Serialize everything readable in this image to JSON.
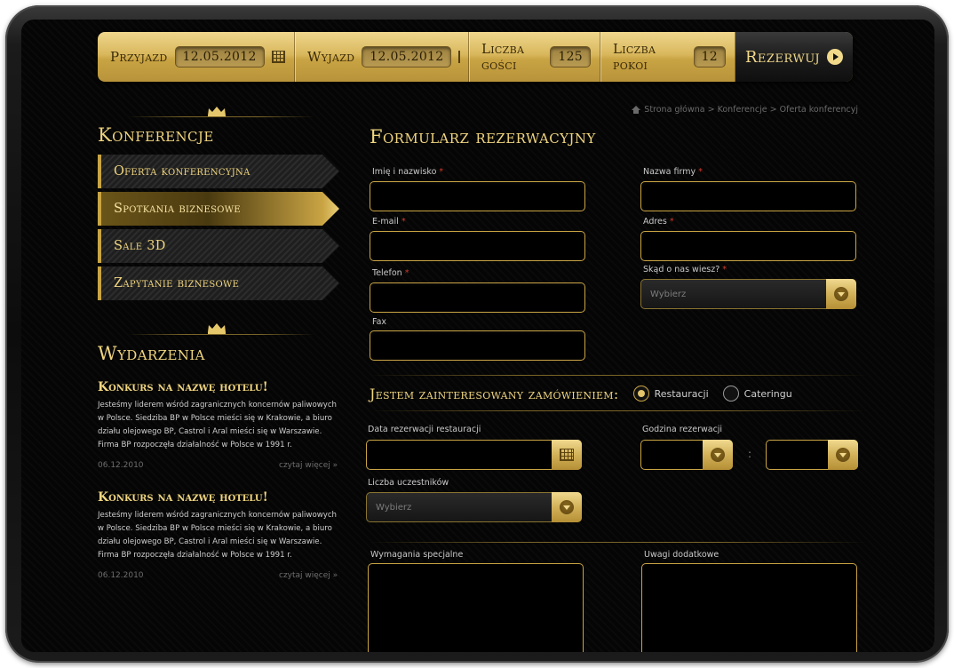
{
  "booking_bar": {
    "arrival_label": "Przyjazd",
    "arrival_value": "12.05.2012",
    "departure_label": "Wyjazd",
    "departure_value": "12.05.2012",
    "guests_label": "Liczba gości",
    "guests_value": "125",
    "rooms_label": "Liczba pokoi",
    "rooms_value": "12",
    "reserve_label": "Rezerwuj"
  },
  "breadcrumb": {
    "text": "Strona główna > Konferencje > Oferta konferencyj"
  },
  "sidebar": {
    "title": "Konferencje",
    "items": [
      {
        "label": "Oferta konferencyjna"
      },
      {
        "label": "Spotkania biznesowe"
      },
      {
        "label": "Sale 3D"
      },
      {
        "label": "Zapytanie biznesowe"
      }
    ]
  },
  "events": {
    "title": "Wydarzenia",
    "items": [
      {
        "title": "Konkurs na nazwę hotelu!",
        "body": "Jesteśmy liderem wśród zagranicznych koncernów paliwowych w Polsce. Siedziba BP w Polsce mieści się w Krakowie, a biuro działu olejowego BP, Castrol i Aral mieści się w Warszawie. Firma BP rozpoczęła działalność w Polsce w 1991 r.",
        "date": "06.12.2010",
        "more": "czytaj więcej »"
      },
      {
        "title": "Konkurs na nazwę hotelu!",
        "body": "Jesteśmy liderem wśród zagranicznych koncernów paliwowych w Polsce. Siedziba BP w Polsce mieści się w Krakowie, a biuro działu olejowego BP, Castrol i Aral mieści się w Warszawie. Firma BP rozpoczęła działalność w Polsce w 1991 r.",
        "date": "06.12.2010",
        "more": "czytaj więcej »"
      }
    ]
  },
  "form": {
    "title": "Formularz rezerwacyjny",
    "name_label": "Imię i nazwisko",
    "company_label": "Nazwa firmy",
    "email_label": "E-mail",
    "address_label": "Adres",
    "phone_label": "Telefon",
    "source_label": "Skąd o nas wiesz?",
    "source_placeholder": "Wybierz",
    "fax_label": "Fax",
    "required_mark": "*",
    "interest_label": "Jestem zainteresowany zamówieniem:",
    "option_restaurant": "Restauracji",
    "option_catering": "Cateringu",
    "res_date_label": "Data rezerwacji restauracji",
    "res_time_label": "Godzina rezerwacji",
    "time_separator": ":",
    "participants_label": "Liczba uczestników",
    "participants_placeholder": "Wybierz",
    "special_label": "Wymagania specjalne",
    "notes_label": "Uwagi dodatkowe"
  },
  "colors": {
    "accent_gold": "#f0d57f",
    "background": "#050505",
    "required": "#d23b2b"
  }
}
